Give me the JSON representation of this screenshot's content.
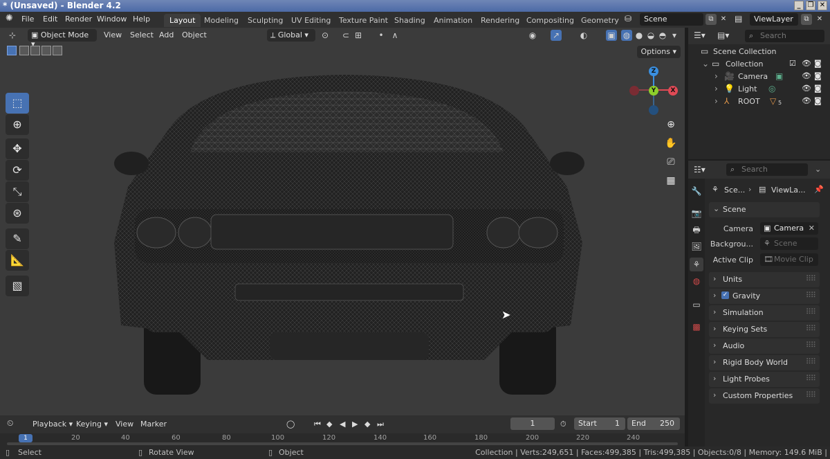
{
  "window": {
    "title": "* (Unsaved) - Blender 4.2",
    "buttons": [
      "_",
      "❐",
      "✕"
    ]
  },
  "topbar": {
    "menus": [
      "File",
      "Edit",
      "Render",
      "Window",
      "Help"
    ],
    "workspaces": [
      "Layout",
      "Modeling",
      "Sculpting",
      "UV Editing",
      "Texture Paint",
      "Shading",
      "Animation",
      "Rendering",
      "Compositing",
      "Geometry I"
    ],
    "active_workspace": "Layout",
    "scene_name": "Scene",
    "view_layer": "ViewLayer"
  },
  "viewport": {
    "mode": "Object Mode",
    "menus": [
      "View",
      "Select",
      "Add",
      "Object"
    ],
    "transform_orientation": "Global",
    "options_label": "Options",
    "gizmo": {
      "z": "Z",
      "y": "Y",
      "x": "X"
    }
  },
  "timeline": {
    "menus": [
      "Playback",
      "Keying",
      "View",
      "Marker"
    ],
    "current_frame": "1",
    "start_label": "Start",
    "start_value": "1",
    "end_label": "End",
    "end_value": "250",
    "ruler_ticks": [
      "1",
      "20",
      "40",
      "60",
      "80",
      "100",
      "120",
      "140",
      "160",
      "180",
      "200",
      "220",
      "240"
    ]
  },
  "outliner": {
    "search_placeholder": "Search",
    "root": "Scene Collection",
    "collection": "Collection",
    "items": [
      "Camera",
      "Light",
      "ROOT"
    ],
    "root_badge": "5"
  },
  "properties": {
    "search_placeholder": "Search",
    "breadcrumb_scene": "Sce...",
    "breadcrumb_layer": "ViewLa...",
    "scene_panel": "Scene",
    "camera_label": "Camera",
    "camera_value": "Camera",
    "background_label": "Backgrou...",
    "background_placeholder": "Scene",
    "clip_label": "Active Clip",
    "clip_placeholder": "Movie Clip",
    "panels": [
      "Units",
      "Gravity",
      "Simulation",
      "Keying Sets",
      "Audio",
      "Rigid Body World",
      "Light Probes",
      "Custom Properties"
    ]
  },
  "statusbar": {
    "select": "Select",
    "rotate": "Rotate View",
    "object": "Object",
    "stats": "Collection | Verts:249,651 | Faces:499,385 | Tris:499,385 | Objects:0/8 | Memory: 149.6 MiB |"
  },
  "colors": {
    "accent": "#4772b3",
    "x_axis": "#e04a55",
    "y_axis": "#8dce2b",
    "z_axis": "#3a8fe0"
  }
}
